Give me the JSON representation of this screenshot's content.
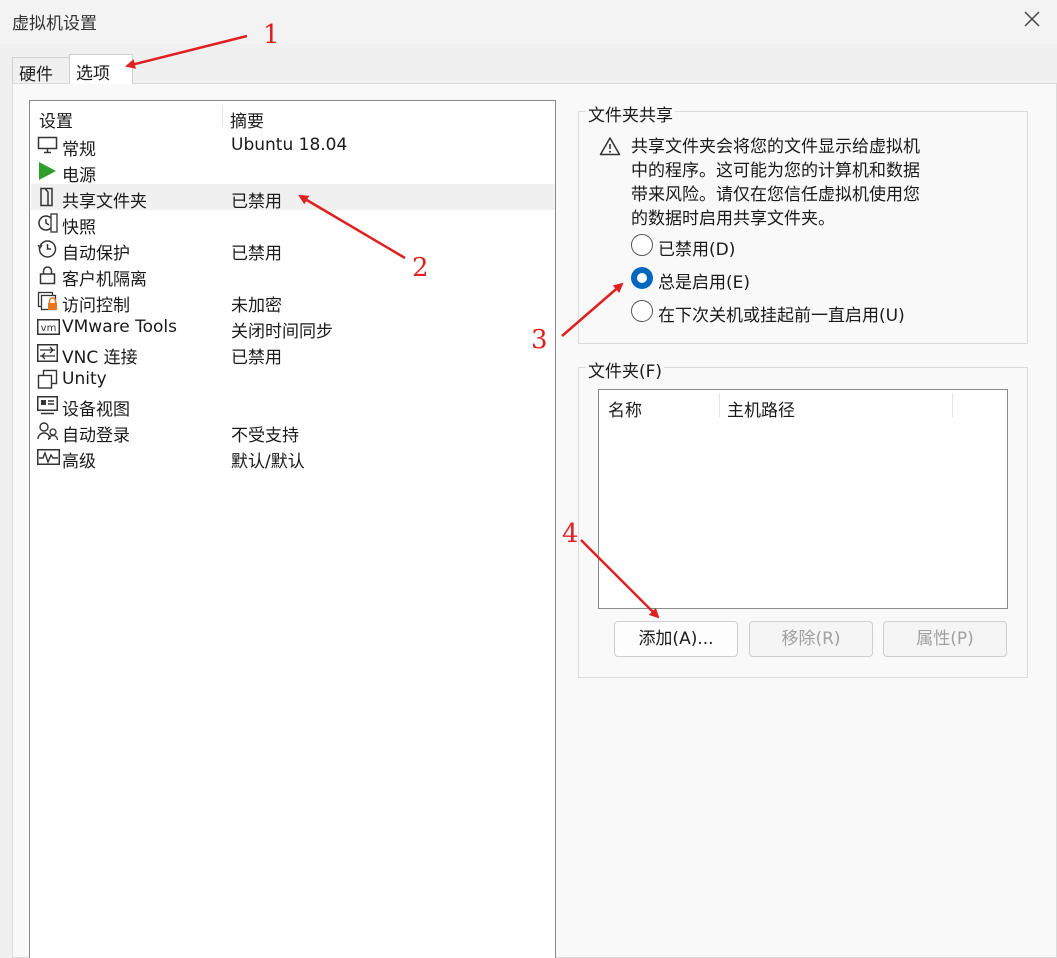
{
  "window": {
    "title": "虚拟机设置",
    "close_icon": "close-icon"
  },
  "tabs": [
    {
      "label": "硬件",
      "selected": false
    },
    {
      "label": "选项",
      "selected": true
    }
  ],
  "settings": {
    "header": {
      "col1": "设置",
      "col2": "摘要"
    },
    "rows": [
      {
        "name": "常规",
        "summary": "Ubuntu 18.04",
        "icon": "monitor-icon"
      },
      {
        "name": "电源",
        "summary": "",
        "icon": "play-icon"
      },
      {
        "name": "共享文件夹",
        "summary": "已禁用",
        "icon": "shared-folder-icon",
        "selected": true
      },
      {
        "name": "快照",
        "summary": "",
        "icon": "snapshot-icon"
      },
      {
        "name": "自动保护",
        "summary": "已禁用",
        "icon": "clock-icon"
      },
      {
        "name": "客户机隔离",
        "summary": "",
        "icon": "lock-icon"
      },
      {
        "name": "访问控制",
        "summary": "未加密",
        "icon": "access-control-icon"
      },
      {
        "name": "VMware Tools",
        "summary": "关闭时间同步",
        "icon": "vm-icon"
      },
      {
        "name": "VNC 连接",
        "summary": "已禁用",
        "icon": "vnc-icon"
      },
      {
        "name": "Unity",
        "summary": "",
        "icon": "unity-icon"
      },
      {
        "name": "设备视图",
        "summary": "",
        "icon": "device-view-icon"
      },
      {
        "name": "自动登录",
        "summary": "不受支持",
        "icon": "users-icon"
      },
      {
        "name": "高级",
        "summary": "默认/默认",
        "icon": "advanced-icon"
      }
    ]
  },
  "folder_sharing": {
    "title": "文件夹共享",
    "warning_lines": [
      "共享文件夹会将您的文件显示给虚拟机",
      "中的程序。这可能为您的计算机和数据",
      "带来风险。请仅在您信任虚拟机使用您",
      "的数据时启用共享文件夹。"
    ],
    "options": [
      {
        "label": "已禁用(D)",
        "checked": false
      },
      {
        "label": "总是启用(E)",
        "checked": true
      },
      {
        "label": "在下次关机或挂起前一直启用(U)",
        "checked": false
      }
    ]
  },
  "folders": {
    "title": "文件夹(F)",
    "columns": [
      "名称",
      "主机路径"
    ],
    "buttons": {
      "add": "添加(A)...",
      "remove": "移除(R)",
      "properties": "属性(P)"
    }
  },
  "annotations": [
    "1",
    "2",
    "3",
    "4"
  ],
  "colors": {
    "accent": "#0067c0",
    "annotation": "#e02020",
    "play_green": "#2e9e2e",
    "lock_orange": "#e87722"
  }
}
